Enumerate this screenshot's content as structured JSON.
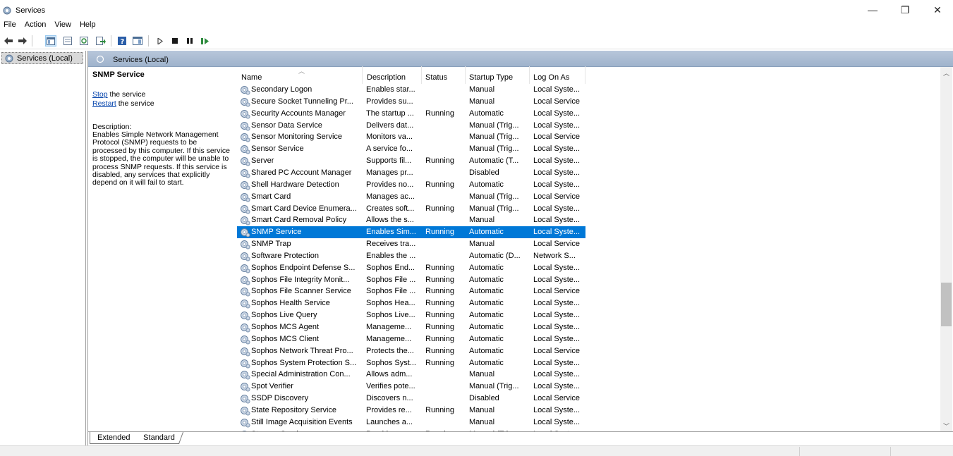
{
  "window": {
    "title": "Services",
    "minimize_glyph": "—",
    "maximize_glyph": "❐",
    "close_glyph": "✕"
  },
  "menu": [
    "File",
    "Action",
    "View",
    "Help"
  ],
  "toolbar": {
    "icons": [
      "back-icon",
      "forward-icon",
      "show-hide-console-tree-icon",
      "properties-icon",
      "refresh-icon",
      "export-list-icon",
      "help-icon",
      "show-action-pane-icon",
      "start-service-icon",
      "stop-service-icon",
      "pause-service-icon",
      "resume-service-icon"
    ]
  },
  "tree": {
    "root_label": "Services (Local)"
  },
  "pane": {
    "header_title": "Services (Local)",
    "selected_service_name": "SNMP Service",
    "stop_link": "Stop",
    "stop_suffix": " the service",
    "restart_link": "Restart",
    "restart_suffix": " the service",
    "description_label": "Description:",
    "description_text": "Enables Simple Network Management Protocol (SNMP) requests to be processed by this computer. If this service is stopped, the computer will be unable to process SNMP requests. If this service is disabled, any services that explicitly depend on it will fail to start."
  },
  "columns": [
    "Name",
    "Description",
    "Status",
    "Startup Type",
    "Log On As"
  ],
  "services": [
    {
      "name": "Secondary Logon",
      "description": "Enables star...",
      "status": "",
      "startup": "Manual",
      "logon": "Local Syste..."
    },
    {
      "name": "Secure Socket Tunneling Pr...",
      "description": "Provides su...",
      "status": "",
      "startup": "Manual",
      "logon": "Local Service"
    },
    {
      "name": "Security Accounts Manager",
      "description": "The startup ...",
      "status": "Running",
      "startup": "Automatic",
      "logon": "Local Syste..."
    },
    {
      "name": "Sensor Data Service",
      "description": "Delivers dat...",
      "status": "",
      "startup": "Manual (Trig...",
      "logon": "Local Syste..."
    },
    {
      "name": "Sensor Monitoring Service",
      "description": "Monitors va...",
      "status": "",
      "startup": "Manual (Trig...",
      "logon": "Local Service"
    },
    {
      "name": "Sensor Service",
      "description": "A service fo...",
      "status": "",
      "startup": "Manual (Trig...",
      "logon": "Local Syste..."
    },
    {
      "name": "Server",
      "description": "Supports fil...",
      "status": "Running",
      "startup": "Automatic (T...",
      "logon": "Local Syste..."
    },
    {
      "name": "Shared PC Account Manager",
      "description": "Manages pr...",
      "status": "",
      "startup": "Disabled",
      "logon": "Local Syste..."
    },
    {
      "name": "Shell Hardware Detection",
      "description": "Provides no...",
      "status": "Running",
      "startup": "Automatic",
      "logon": "Local Syste..."
    },
    {
      "name": "Smart Card",
      "description": "Manages ac...",
      "status": "",
      "startup": "Manual (Trig...",
      "logon": "Local Service"
    },
    {
      "name": "Smart Card Device Enumera...",
      "description": "Creates soft...",
      "status": "Running",
      "startup": "Manual (Trig...",
      "logon": "Local Syste..."
    },
    {
      "name": "Smart Card Removal Policy",
      "description": "Allows the s...",
      "status": "",
      "startup": "Manual",
      "logon": "Local Syste..."
    },
    {
      "name": "SNMP Service",
      "description": "Enables Sim...",
      "status": "Running",
      "startup": "Automatic",
      "logon": "Local Syste...",
      "selected": true
    },
    {
      "name": "SNMP Trap",
      "description": "Receives tra...",
      "status": "",
      "startup": "Manual",
      "logon": "Local Service"
    },
    {
      "name": "Software Protection",
      "description": "Enables the ...",
      "status": "",
      "startup": "Automatic (D...",
      "logon": "Network S..."
    },
    {
      "name": "Sophos Endpoint Defense S...",
      "description": "Sophos End...",
      "status": "Running",
      "startup": "Automatic",
      "logon": "Local Syste..."
    },
    {
      "name": "Sophos File Integrity Monit...",
      "description": "Sophos File ...",
      "status": "Running",
      "startup": "Automatic",
      "logon": "Local Syste..."
    },
    {
      "name": "Sophos File Scanner Service",
      "description": "Sophos File ...",
      "status": "Running",
      "startup": "Automatic",
      "logon": "Local Service"
    },
    {
      "name": "Sophos Health Service",
      "description": "Sophos Hea...",
      "status": "Running",
      "startup": "Automatic",
      "logon": "Local Syste..."
    },
    {
      "name": "Sophos Live Query",
      "description": "Sophos Live...",
      "status": "Running",
      "startup": "Automatic",
      "logon": "Local Syste..."
    },
    {
      "name": "Sophos MCS Agent",
      "description": "Manageme...",
      "status": "Running",
      "startup": "Automatic",
      "logon": "Local Syste..."
    },
    {
      "name": "Sophos MCS Client",
      "description": "Manageme...",
      "status": "Running",
      "startup": "Automatic",
      "logon": "Local Syste..."
    },
    {
      "name": "Sophos Network Threat Pro...",
      "description": "Protects the...",
      "status": "Running",
      "startup": "Automatic",
      "logon": "Local Service"
    },
    {
      "name": "Sophos System Protection S...",
      "description": "Sophos Syst...",
      "status": "Running",
      "startup": "Automatic",
      "logon": "Local Syste..."
    },
    {
      "name": "Special Administration Con...",
      "description": "Allows adm...",
      "status": "",
      "startup": "Manual",
      "logon": "Local Syste..."
    },
    {
      "name": "Spot Verifier",
      "description": "Verifies pote...",
      "status": "",
      "startup": "Manual (Trig...",
      "logon": "Local Syste..."
    },
    {
      "name": "SSDP Discovery",
      "description": "Discovers n...",
      "status": "",
      "startup": "Disabled",
      "logon": "Local Service"
    },
    {
      "name": "State Repository Service",
      "description": "Provides re...",
      "status": "Running",
      "startup": "Manual",
      "logon": "Local Syste..."
    },
    {
      "name": "Still Image Acquisition Events",
      "description": "Launches a...",
      "status": "",
      "startup": "Manual",
      "logon": "Local Syste..."
    },
    {
      "name": "Storage Service",
      "description": "Provides en...",
      "status": "Running",
      "startup": "Manual (Trig...",
      "logon": "Local Syste..."
    }
  ],
  "tabs": [
    "Extended",
    "Standard"
  ],
  "colors": {
    "selection": "#0078d7",
    "header_gradient_top": "#b7c6da",
    "header_gradient_bottom": "#9fb3cc",
    "link": "#0645ad"
  }
}
